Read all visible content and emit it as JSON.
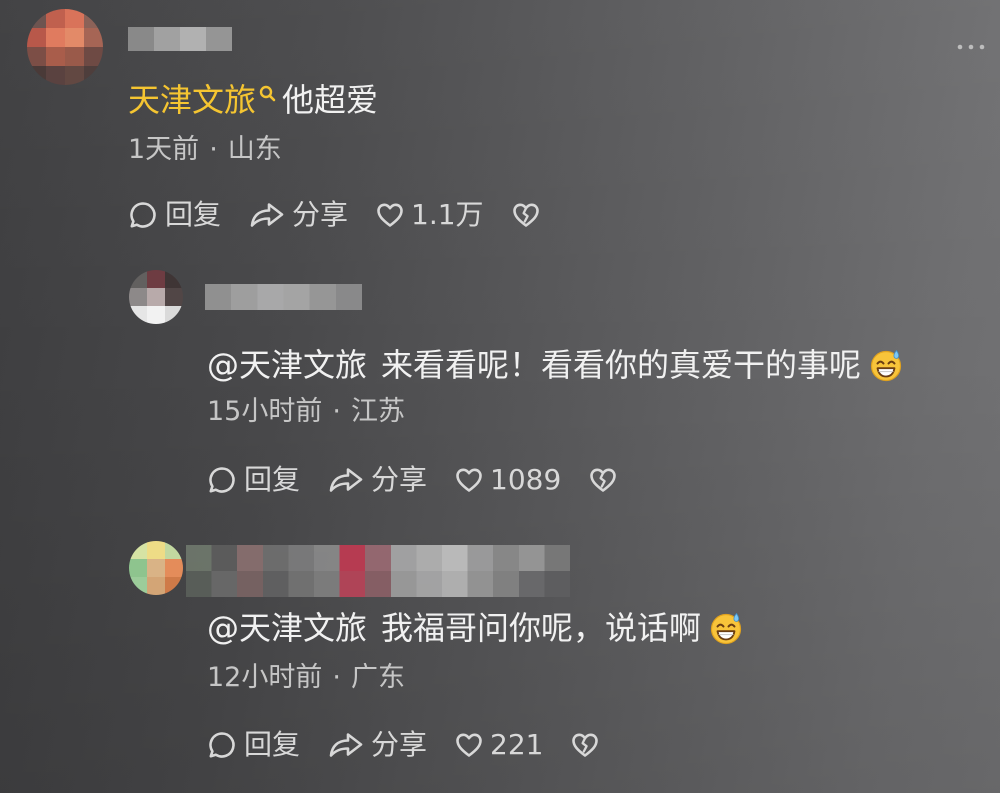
{
  "colors": {
    "highlight": "#f5c531",
    "text": "#f1f1f1",
    "meta": "#c6c6c6",
    "action": "#d8d8d8"
  },
  "icons": {
    "more": "more-icon",
    "search": "search-icon",
    "reply": "comment-icon",
    "share": "share-icon",
    "like": "heart-icon",
    "dislike": "broken-heart-icon",
    "emoji": "grinning-sweat-emoji"
  },
  "thread": {
    "comment": {
      "highlight": "天津文旅",
      "text": "他超爱",
      "time": "1天前",
      "separator": "·",
      "location": "山东",
      "reply_label": "回复",
      "share_label": "分享",
      "likes": "1.1万"
    },
    "replies": [
      {
        "mention": "@天津文旅",
        "text": "来看看呢！看看你的真爱干的事呢",
        "emoji": "grinning-sweat-emoji",
        "time": "15小时前",
        "separator": "·",
        "location": "江苏",
        "reply_label": "回复",
        "share_label": "分享",
        "likes": "1089"
      },
      {
        "mention": "@天津文旅",
        "text": "我福哥问你呢，说话啊",
        "emoji": "grinning-sweat-emoji",
        "time": "12小时前",
        "separator": "·",
        "location": "广东",
        "reply_label": "回复",
        "share_label": "分享",
        "likes": "221"
      }
    ]
  }
}
